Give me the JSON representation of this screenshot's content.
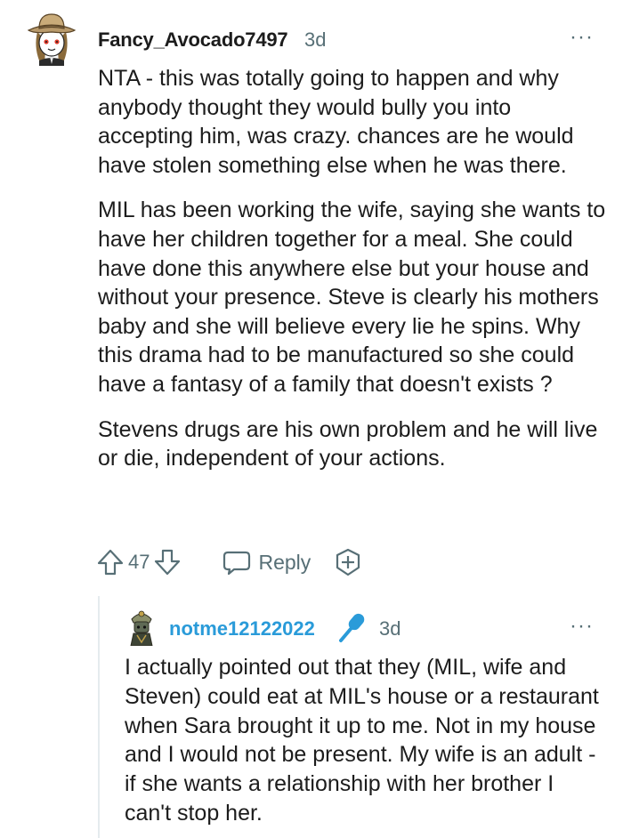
{
  "comment": {
    "author": "Fancy_Avocado7497",
    "time": "3d",
    "more_icon": "···",
    "paragraphs": [
      "NTA - this was totally going to happen and why anybody thought they would bully you into accepting him, was crazy. chances are he would have stolen something else when he was there.",
      "MIL has been working the wife, saying she wants to have her children together for a meal. She could have done this anywhere else but your house and without your presence. Steve is clearly his mothers baby and she will believe every lie he spins. Why this drama had to be manufactured so she could have a fantasy of a family that doesn't exists ?",
      "Stevens drugs are his own problem and he will live or die, independent of your actions."
    ],
    "actions": {
      "upvote_icon": "upvote-arrow-icon",
      "vote_count": "47",
      "downvote_icon": "downvote-arrow-icon",
      "reply_label": "Reply",
      "award_icon": "add-award-icon"
    }
  },
  "reply": {
    "author": "notme12122022",
    "flair_icon": "microphone-icon",
    "time": "3d",
    "more_icon": "···",
    "paragraphs": [
      "I actually pointed out that they (MIL, wife and Steven) could eat at MIL's house or a restaurant when Sara brought it up to me. Not in my house and I would not be present. My wife is an adult - if she wants a relationship with her brother I can't stop her."
    ]
  },
  "colors": {
    "text": "#1c1c1c",
    "meta": "#576f76",
    "reply_author": "#2a9bd9",
    "thread_line": "#e5ebee"
  }
}
